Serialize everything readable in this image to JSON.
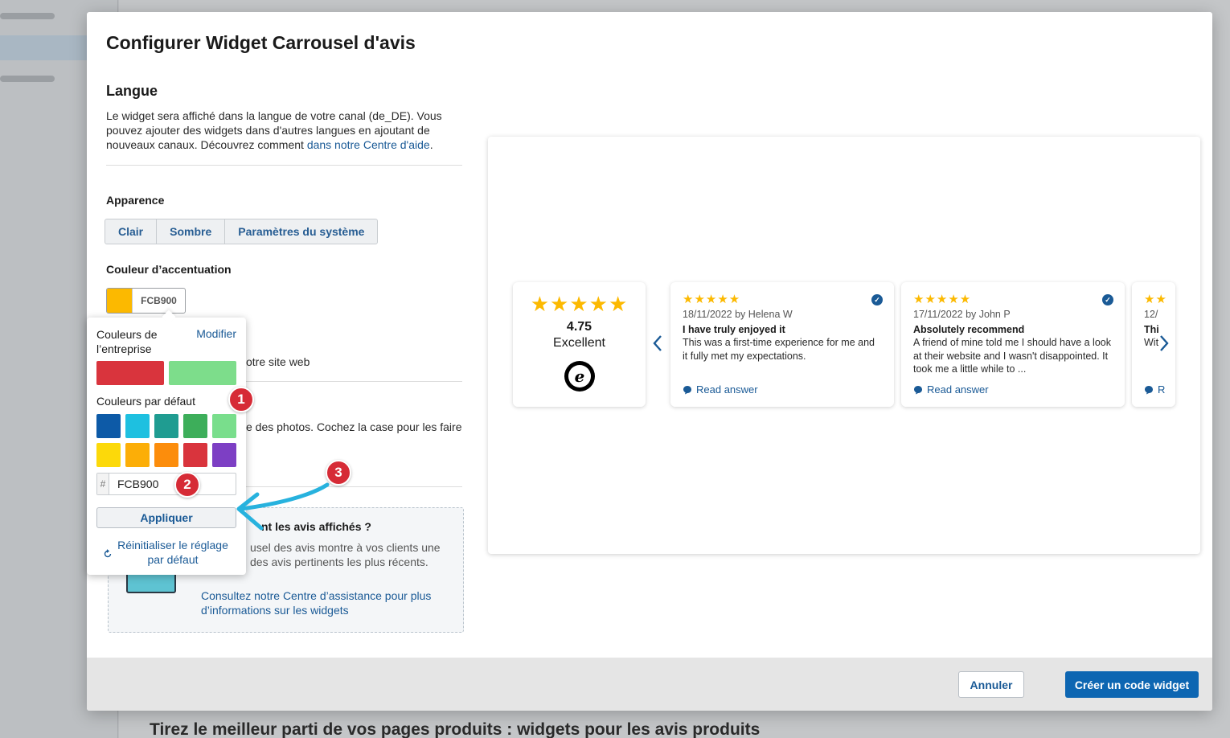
{
  "background": {
    "heading": "Tirez le meilleur parti de vos pages produits : widgets pour les avis produits"
  },
  "modal": {
    "title": "Configurer Widget Carrousel d'avis",
    "language": {
      "heading": "Langue",
      "text": "Le widget sera affiché dans la langue de votre canal (de_DE). Vous pouvez ajouter des widgets dans d'autres langues en ajoutant de nouveaux canaux. Découvrez comment",
      "link": "dans notre Centre d'aide",
      "link_suffix": "."
    },
    "appearance": {
      "label": "Apparence",
      "options": [
        "Clair",
        "Sombre",
        "Paramètres du système"
      ]
    },
    "accent": {
      "label": "Couleur d’accentuation",
      "value": "FCB900",
      "color": "#FCB900"
    },
    "partial_texts": {
      "website": "otre site web",
      "photos": "e des photos. Cochez la case pour les faire"
    },
    "info": {
      "title": "nt les avis affichés ?",
      "text": "usel des avis montre à vos clients une des avis pertinents les plus récents.",
      "link": "Consultez notre Centre d’assistance pour plus d’informations sur les widgets"
    },
    "footer": {
      "cancel": "Annuler",
      "create": "Créer un code widget"
    }
  },
  "color_popover": {
    "company_label": "Couleurs de l’entreprise",
    "modify": "Modifier",
    "company_colors": [
      "#d9343d",
      "#7ddd8b"
    ],
    "default_label": "Couleurs par défaut",
    "default_colors": [
      "#0d5aa7",
      "#1ec0e0",
      "#1f9c91",
      "#3dae5a",
      "#79de8c",
      "#fcd90a",
      "#fcae07",
      "#fc8d0c",
      "#d9343d",
      "#7d3fc4"
    ],
    "hash": "#",
    "hex_value": "FCB900",
    "apply": "Appliquer",
    "reset": "Réinitialiser le réglage par défaut"
  },
  "annotations": [
    "1",
    "2",
    "3"
  ],
  "preview": {
    "rating": {
      "stars": "★★★★★",
      "score": "4.75",
      "label": "Excellent",
      "logo": "e"
    },
    "reviews": [
      {
        "stars": "★★★★★",
        "meta": "18/11/2022 by Helena W",
        "title": "I have truly enjoyed it",
        "text": "This was a first-time experience for me and it fully met my expectations.",
        "answer": "Read answer"
      },
      {
        "stars": "★★★★★",
        "meta": "17/11/2022 by John P",
        "title": "Absolutely recommend",
        "text": "A friend of mine told me I should have a look at their website and I wasn't disappointed. It took me a little while to ...",
        "answer": "Read answer"
      },
      {
        "stars": "★★",
        "meta": "12/",
        "title": "Thi",
        "text": "Wit",
        "answer": "R"
      }
    ]
  }
}
